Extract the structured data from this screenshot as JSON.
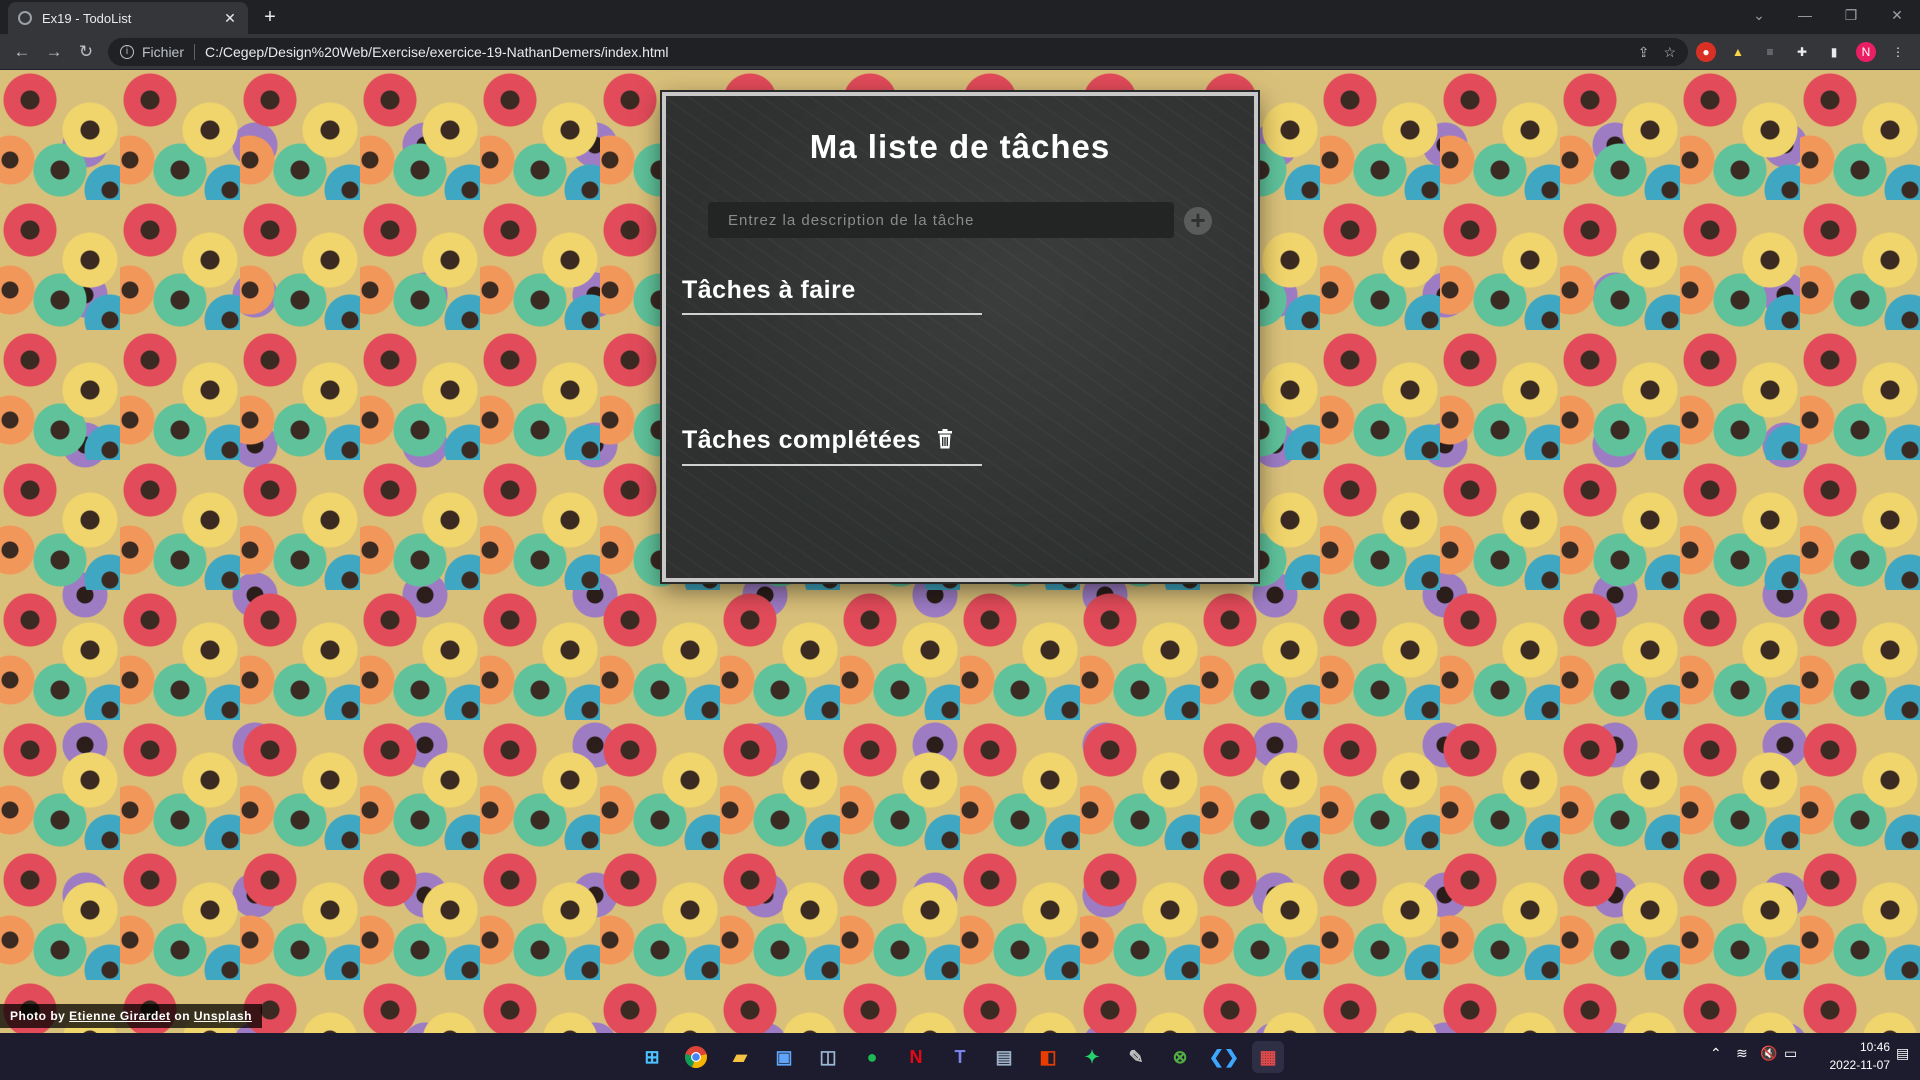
{
  "browser": {
    "tab_title": "Ex19 - TodoList",
    "new_tab": "+",
    "scheme": "Fichier",
    "url": "C:/Cegep/Design%20Web/Exercise/exercice-19-NathanDemers/index.html",
    "profile_initial": "N"
  },
  "app": {
    "title": "Ma liste de tâches",
    "input_placeholder": "Entrez la description de la tâche",
    "add_symbol": "+",
    "todo_heading": "Tâches à faire",
    "done_heading": "Tâches complétées"
  },
  "credit": {
    "prefix": "Photo by",
    "author": "Etienne Girardet",
    "middle": "on",
    "site": "Unsplash"
  },
  "taskbar": {
    "time": "10:46",
    "date": "2022-11-07"
  },
  "colors": {
    "accent_red": "#e34a4a",
    "panel_bg": "#2e3130"
  }
}
